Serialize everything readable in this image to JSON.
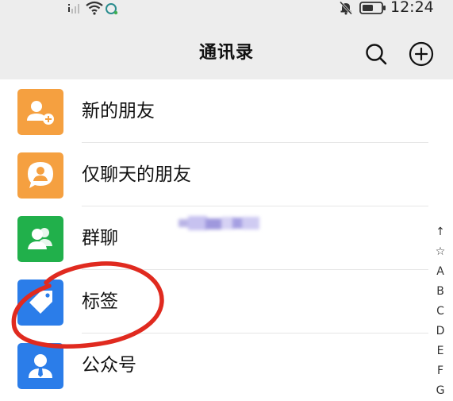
{
  "status_bar": {
    "time": "12:24",
    "icons": [
      "signal-icon",
      "wifi-icon",
      "hd-icon",
      "mute-bell-icon",
      "battery-icon"
    ]
  },
  "header": {
    "title": "通讯录",
    "search_icon": "search-icon",
    "add_icon": "plus-circle-icon"
  },
  "contacts_menu": [
    {
      "label": "新的朋友",
      "icon": "add-friend-icon",
      "color": "#f5a040"
    },
    {
      "label": "仅聊天的朋友",
      "icon": "chat-only-friend-icon",
      "color": "#f5a040"
    },
    {
      "label": "群聊",
      "icon": "group-chat-icon",
      "color": "#21b04b"
    },
    {
      "label": "标签",
      "icon": "tag-icon",
      "color": "#2b7de9"
    },
    {
      "label": "公众号",
      "icon": "official-account-icon",
      "color": "#2b7de9"
    }
  ],
  "alphabet_index": [
    "↑",
    "☆",
    "A",
    "B",
    "C",
    "D",
    "E",
    "F",
    "G"
  ],
  "annotation": {
    "color": "#e02a1f"
  }
}
